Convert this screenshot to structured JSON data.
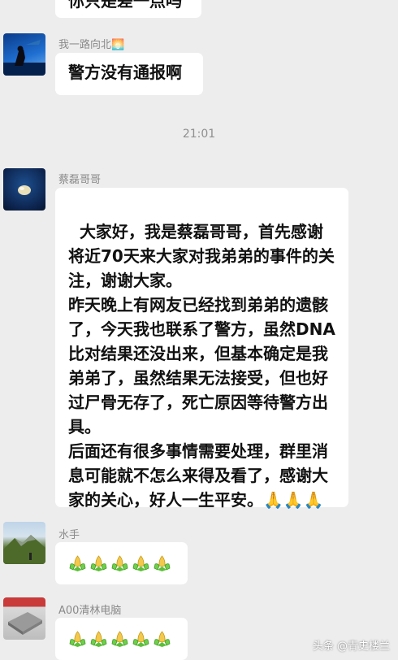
{
  "chat": {
    "top_partial_text": "你只是差一点吗",
    "messages": [
      {
        "sender": "我一路向北🌅",
        "text": "警方没有通报啊"
      },
      {
        "sender": "蔡磊哥哥",
        "text": "大家好，我是蔡磊哥哥，首先感谢将近70天来大家对我弟弟的事件的关注，谢谢大家。\n昨天晚上有网友已经找到弟弟的遗骸了，今天我也联系了警方，虽然DNA比对结果还没出来，但基本确定是我弟弟了，虽然结果无法接受，但也好过尸骨无存了，死亡原因等待警方出具。\n后面还有很多事情需要处理，群里消息可能就不怎么来得及看了，感谢大家的关心，好人一生平安。🙏🙏🙏"
      },
      {
        "sender": "水手",
        "emoji_count": 5,
        "emoji_name": "hands-folded-emoji"
      },
      {
        "sender": "A00清林电脑",
        "emoji_count": 5,
        "emoji_name": "hands-folded-emoji"
      }
    ],
    "timestamp": "21:01"
  },
  "watermark": {
    "text": "头条 @青史楼兰"
  }
}
